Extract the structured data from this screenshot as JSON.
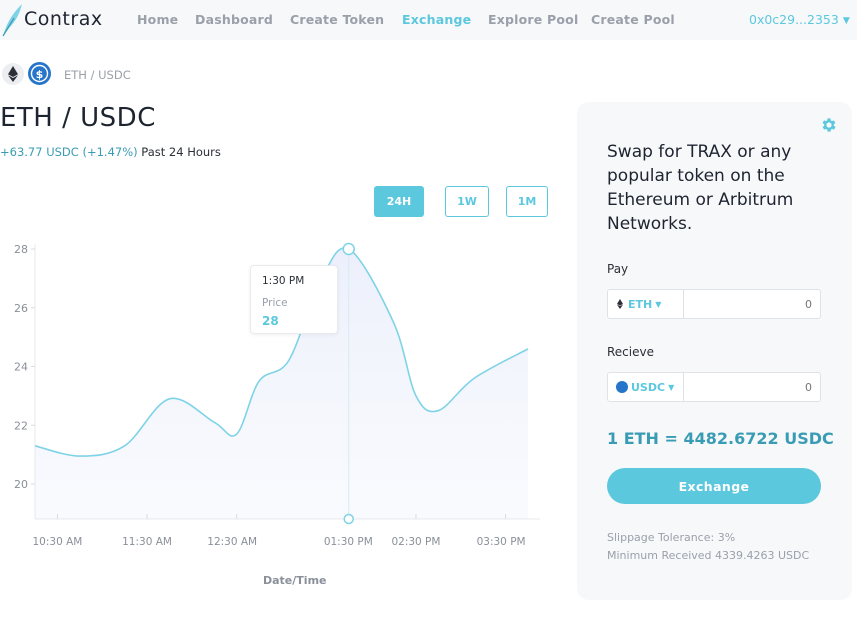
{
  "nav": {
    "brand": "Contrax",
    "links": [
      "Home",
      "Dashboard",
      "Create Token",
      "Exchange",
      "Explore Pool",
      "Create Pool"
    ],
    "active": "Exchange",
    "wallet": "0x0c29...2353"
  },
  "pair": {
    "breadcrumb": "ETH / USDC",
    "title": "ETH / USDC",
    "change": "+63.77 USDC (+1.47%)",
    "period": "Past 24 Hours",
    "ranges": [
      "24H",
      "1W",
      "1M"
    ],
    "active_range": "24H"
  },
  "tooltip": {
    "time": "1:30 PM",
    "label": "Price",
    "value": "28"
  },
  "chart_data": {
    "type": "area",
    "xlabel": "Date/Time",
    "ylabel": "",
    "x_ticks": [
      "10:30 AM",
      "11:30 AM",
      "12:30 AM",
      "01:30 PM",
      "02:30 PM",
      "03:30 PM"
    ],
    "y_ticks": [
      20,
      22,
      24,
      26,
      28
    ],
    "ylim": [
      19,
      28.5
    ],
    "series": [
      {
        "points": [
          {
            "t": 10.0,
            "y": 21.3
          },
          {
            "t": 10.5,
            "y": 20.95
          },
          {
            "t": 11.0,
            "y": 21.3
          },
          {
            "t": 11.5,
            "y": 22.9
          },
          {
            "t": 12.0,
            "y": 22.1
          },
          {
            "t": 12.25,
            "y": 21.7
          },
          {
            "t": 12.5,
            "y": 23.5
          },
          {
            "t": 12.83,
            "y": 24.2
          },
          {
            "t": 13.17,
            "y": 26.8
          },
          {
            "t": 13.5,
            "y": 28.0
          },
          {
            "t": 14.0,
            "y": 25.5
          },
          {
            "t": 14.25,
            "y": 23.0
          },
          {
            "t": 14.5,
            "y": 22.5
          },
          {
            "t": 14.9,
            "y": 23.6
          },
          {
            "t": 15.5,
            "y": 24.6
          }
        ]
      }
    ],
    "highlight": {
      "t": 13.5,
      "y": 28
    },
    "line_color": "#7fd3e6",
    "fill_color": "#eef2fb",
    "grid": false
  },
  "swap": {
    "heading": "Swap for TRAX or any popular token on the Ethereum or Arbitrum Networks.",
    "pay_label": "Pay",
    "pay_token": "ETH",
    "pay_amount": "0",
    "receive_label": "Recieve",
    "receive_token": "USDC",
    "receive_amount": "0",
    "rate": "1 ETH = 4482.6722 USDC",
    "button": "Exchange",
    "slippage": "Slippage Tolerance: 3%",
    "minimum": "Minimum Received 4339.4263 USDC"
  },
  "colors": {
    "accent": "#5bc8de",
    "accent_dark": "#3a9cb4",
    "usdc": "#2775ca"
  },
  "icons": {
    "settings": "gear-icon",
    "eth": "ethereum-icon",
    "usdc": "usdc-icon",
    "logo": "feather-icon"
  }
}
